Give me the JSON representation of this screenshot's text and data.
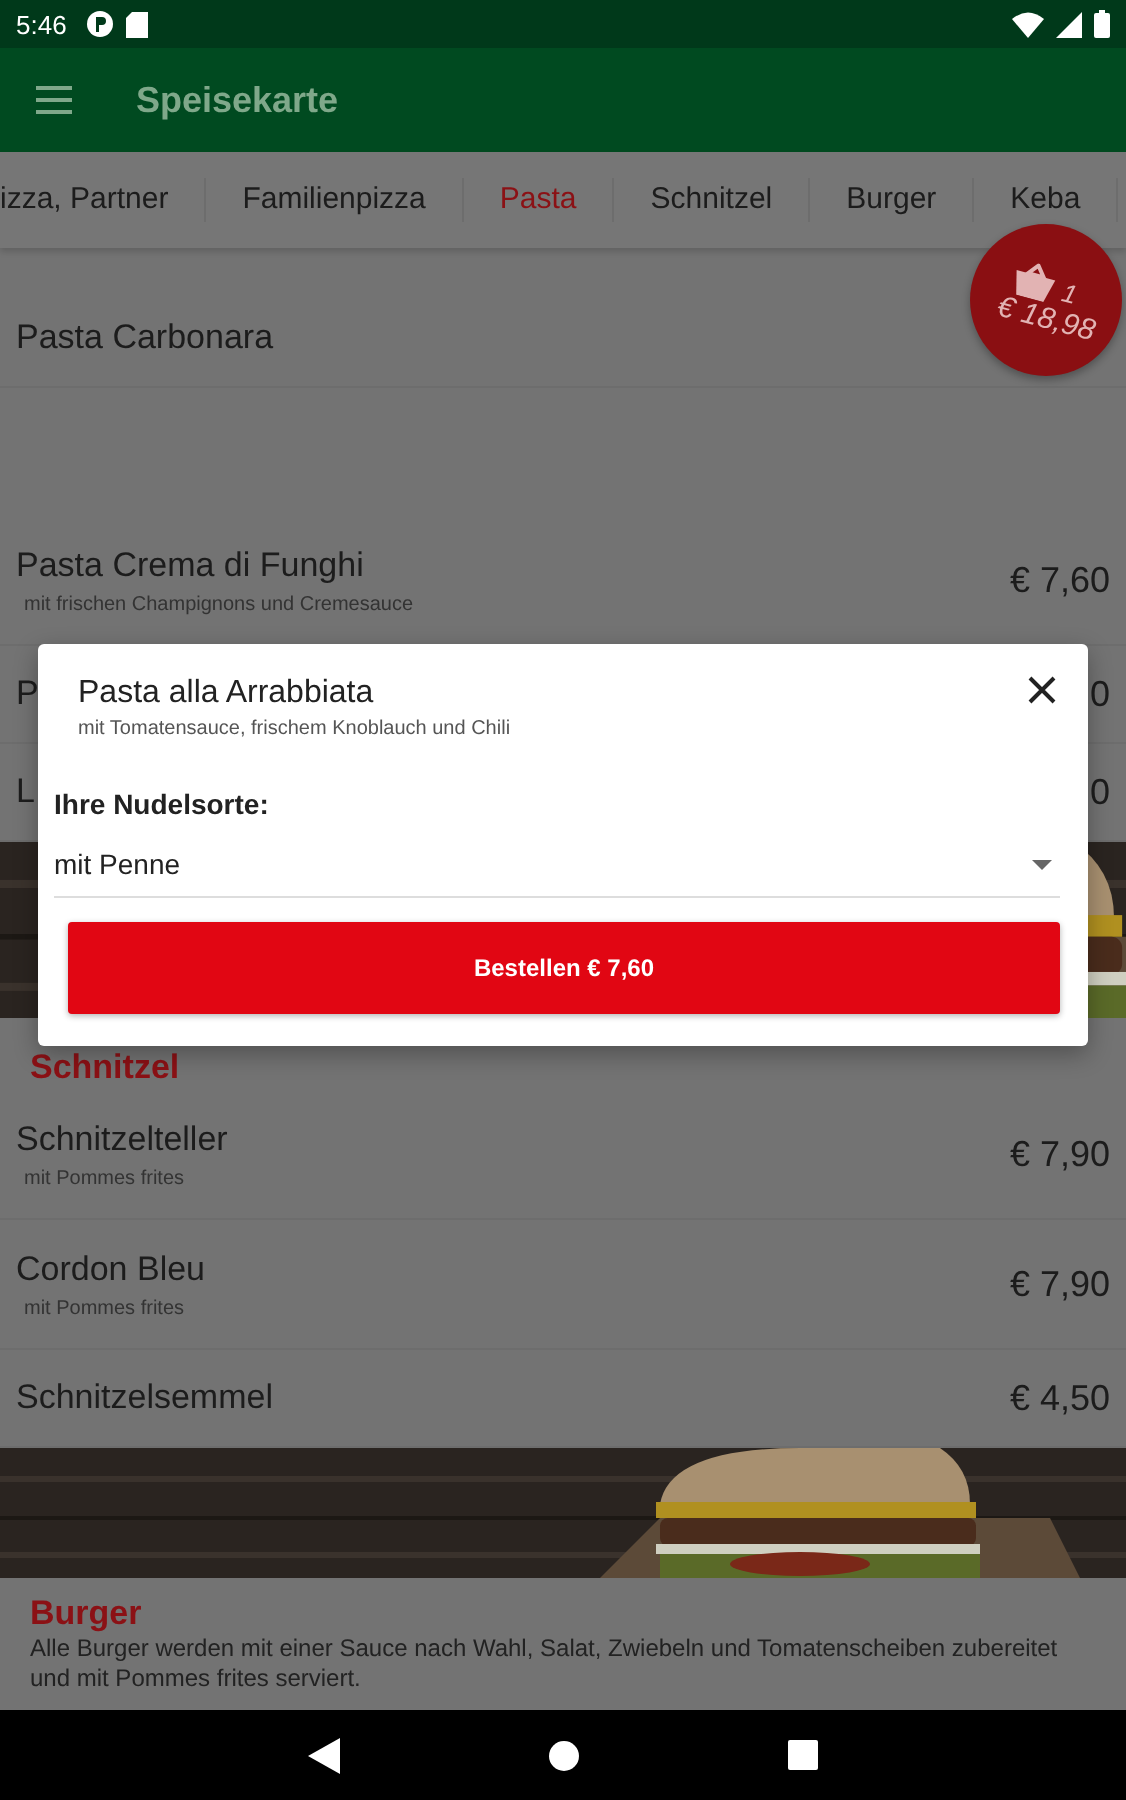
{
  "status_bar": {
    "time": "5:46"
  },
  "app_bar": {
    "title": "Speisekarte"
  },
  "tabs": [
    {
      "label": "izza, Partner",
      "selected": false
    },
    {
      "label": "Familienpizza",
      "selected": false
    },
    {
      "label": "Pasta",
      "selected": true
    },
    {
      "label": "Schnitzel",
      "selected": false
    },
    {
      "label": "Burger",
      "selected": false
    },
    {
      "label": "Keba",
      "selected": false
    }
  ],
  "cart_badge": {
    "count": "1",
    "total": "€ 18,98"
  },
  "menu": [
    {
      "kind": "item",
      "name": "Pasta Carbonara"
    },
    {
      "kind": "gap"
    },
    {
      "kind": "item",
      "name": "Pasta Crema di Funghi",
      "description": "mit frischen Champignons und Cremesauce",
      "price": "€ 7,60"
    },
    {
      "kind": "item",
      "name": "P",
      "price": "0"
    },
    {
      "kind": "item",
      "name": "L",
      "price": "0"
    },
    {
      "kind": "picture"
    },
    {
      "kind": "section",
      "title": "Schnitzel"
    },
    {
      "kind": "item",
      "name": "Schnitzelteller",
      "description": "mit Pommes frites",
      "price": "€ 7,90"
    },
    {
      "kind": "item",
      "name": "Cordon Bleu",
      "description": "mit Pommes frites",
      "price": "€ 7,90"
    },
    {
      "kind": "item",
      "name": "Schnitzelsemmel",
      "price": "€ 4,50"
    },
    {
      "kind": "picture"
    },
    {
      "kind": "section",
      "title": "Burger",
      "description": "Alle Burger werden mit einer Sauce nach Wahl, Salat, Zwiebeln und Tomatenscheiben zubereitet und mit Pommes frites serviert."
    }
  ],
  "dialog": {
    "title": "Pasta alla Arrabbiata",
    "subtitle": "mit Tomatensauce, frischem Knoblauch und Chili",
    "option_label": "Ihre Nudelsorte:",
    "option_value": "mit Penne",
    "order_button": "Bestellen € 7,60"
  }
}
